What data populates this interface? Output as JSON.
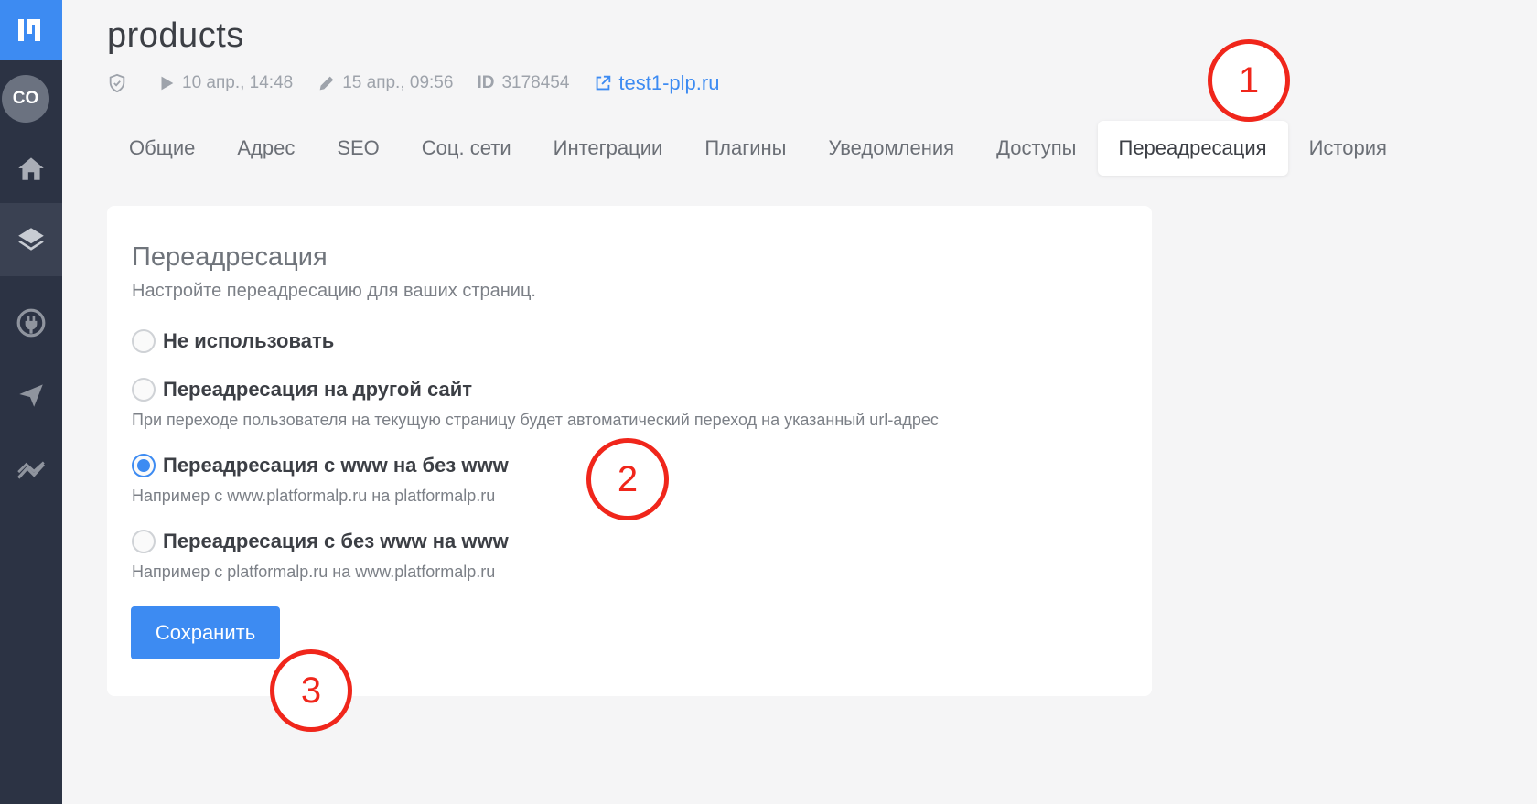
{
  "sidebar": {
    "avatar": "CO",
    "items": [
      {
        "icon": "home-icon"
      },
      {
        "icon": "layers-icon",
        "active": true
      },
      {
        "icon": "plug-icon"
      },
      {
        "icon": "send-icon"
      },
      {
        "icon": "analytics-icon"
      }
    ]
  },
  "header": {
    "title": "products",
    "published": "10 апр., 14:48",
    "edited": "15 апр., 09:56",
    "id_label": "ID",
    "id_value": "3178454",
    "domain": "test1-plp.ru"
  },
  "tabs": [
    "Общие",
    "Адрес",
    "SEO",
    "Соц. сети",
    "Интеграции",
    "Плагины",
    "Уведомления",
    "Доступы",
    "Переадресация",
    "История"
  ],
  "active_tab": "Переадресация",
  "section": {
    "title": "Переадресация",
    "description": "Настройте переадресацию для ваших страниц.",
    "options": [
      {
        "label": "Не использовать",
        "hint": "",
        "checked": false
      },
      {
        "label": "Переадресация на другой сайт",
        "hint": "При переходе пользователя на текущую страницу будет автоматический переход на указанный url-адрес",
        "checked": false
      },
      {
        "label": "Переадресация с www на без www",
        "hint": "Например с www.platformalp.ru на platformalp.ru",
        "checked": true
      },
      {
        "label": "Переадресация с без www на www",
        "hint": "Например с platformalp.ru на www.platformalp.ru",
        "checked": false
      }
    ],
    "save_label": "Сохранить"
  },
  "annotations": [
    "1",
    "2",
    "3"
  ],
  "colors": {
    "accent": "#3d8bf2",
    "annotation": "#f0261b",
    "sidebar": "#2c3344"
  }
}
